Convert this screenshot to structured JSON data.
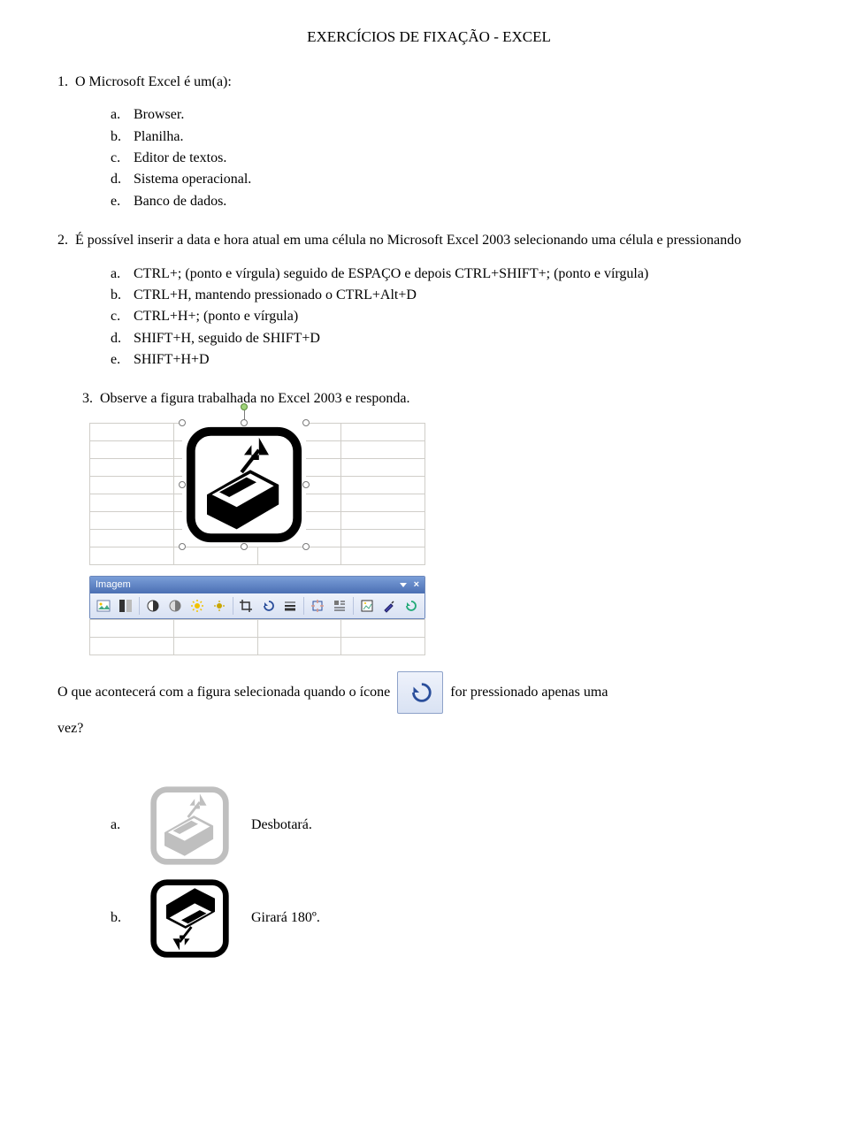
{
  "title": "EXERCÍCIOS DE FIXAÇÃO - EXCEL",
  "q1": {
    "num": "1.",
    "stem": "O Microsoft Excel é um(a):",
    "opts": {
      "a": {
        "l": "a.",
        "t": "Browser."
      },
      "b": {
        "l": "b.",
        "t": "Planilha."
      },
      "c": {
        "l": "c.",
        "t": "Editor de textos."
      },
      "d": {
        "l": "d.",
        "t": "Sistema operacional."
      },
      "e": {
        "l": "e.",
        "t": "Banco de dados."
      }
    }
  },
  "q2": {
    "num": "2.",
    "stem": "É possível inserir a data e hora atual em uma célula no Microsoft Excel 2003 selecionando uma célula e pressionando",
    "opts": {
      "a": {
        "l": "a.",
        "t": "CTRL+; (ponto e vírgula) seguido de ESPAÇO e depois CTRL+SHIFT+; (ponto e vírgula)"
      },
      "b": {
        "l": "b.",
        "t": "CTRL+H, mantendo pressionado o CTRL+Alt+D"
      },
      "c": {
        "l": "c.",
        "t": "CTRL+H+; (ponto e vírgula)"
      },
      "d": {
        "l": "d.",
        "t": "SHIFT+H, seguido de SHIFT+D"
      },
      "e": {
        "l": "e.",
        "t": "SHIFT+H+D"
      }
    }
  },
  "q3": {
    "num": "3.",
    "stem": "Observe a figura trabalhada no Excel 2003 e responda.",
    "toolbar_title": "Imagem",
    "follow_before": "O que acontecerá com a figura selecionada quando o ícone",
    "follow_after": "for pressionado apenas uma",
    "follow_line2": "vez?",
    "opts": {
      "a": {
        "l": "a.",
        "t": "Desbotará."
      },
      "b": {
        "l": "b.",
        "t": "Girará 180º."
      }
    }
  }
}
